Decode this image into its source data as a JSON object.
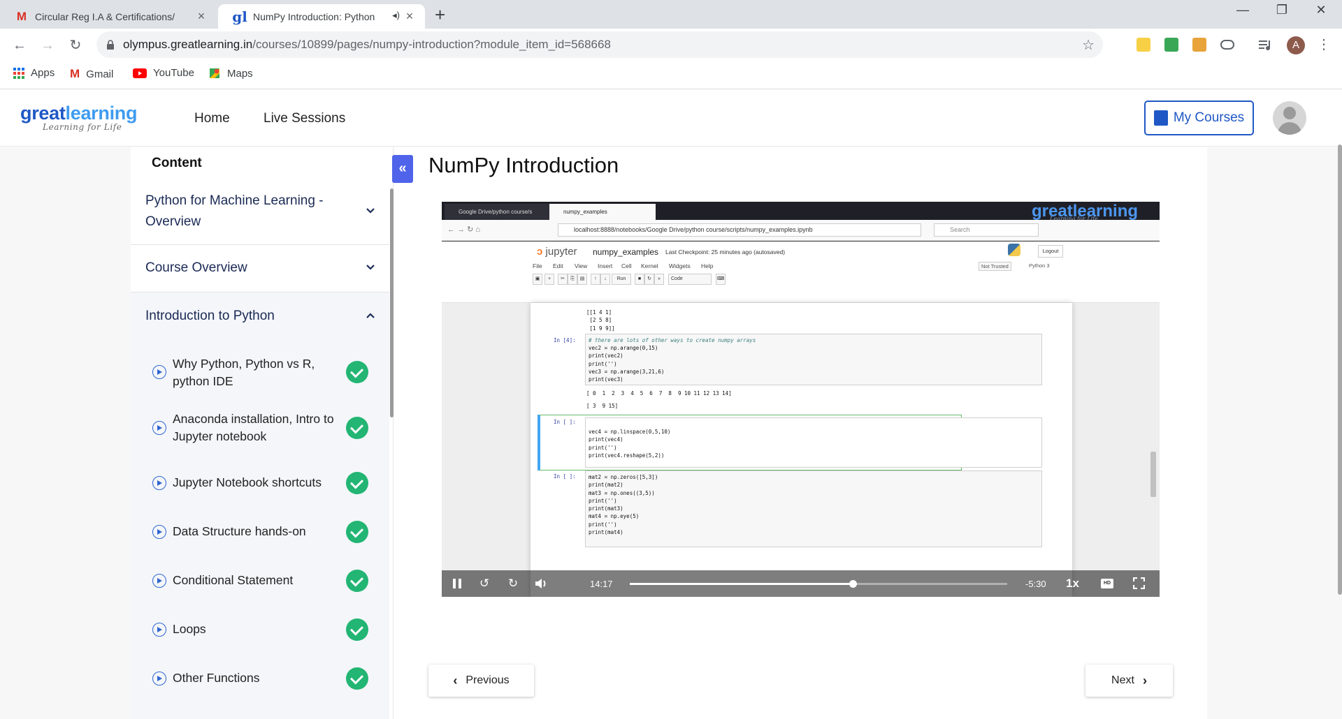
{
  "browser": {
    "tabs": [
      {
        "title": "Circular Reg I.A & Certifications/",
        "icon": "gmail-icon"
      },
      {
        "title": "NumPy Introduction: Python",
        "icon": "greatlearning-icon",
        "active": true
      }
    ],
    "new_tab": "+",
    "url_host": "olympus.greatlearning.in",
    "url_path": "/courses/10899/pages/numpy-introduction?module_item_id=568668",
    "profile_initial": "A",
    "bookmarks": [
      {
        "label": "Apps",
        "icon": "apps-grid-icon"
      },
      {
        "label": "Gmail",
        "icon": "gmail-icon"
      },
      {
        "label": "YouTube",
        "icon": "youtube-icon"
      },
      {
        "label": "Maps",
        "icon": "maps-icon"
      }
    ]
  },
  "site": {
    "logo_main_a": "great",
    "logo_main_b": "learning",
    "logo_tagline": "Learning for Life",
    "nav": [
      "Home",
      "Live Sessions"
    ],
    "my_courses": "My Courses"
  },
  "sidebar": {
    "heading": "Content",
    "modules": [
      {
        "title": "Python for Machine Learning - Overview",
        "expanded": false
      },
      {
        "title": "Course Overview",
        "expanded": false
      },
      {
        "title": "Introduction to Python",
        "expanded": true
      }
    ],
    "lessons": [
      {
        "title": "Why Python, Python vs R, python IDE",
        "completed": true
      },
      {
        "title": "Anaconda installation, Intro to Jupyter notebook",
        "completed": true
      },
      {
        "title": "Jupyter Notebook shortcuts",
        "completed": true
      },
      {
        "title": "Data Structure hands-on",
        "completed": true
      },
      {
        "title": "Conditional Statement",
        "completed": true
      },
      {
        "title": "Loops",
        "completed": true
      },
      {
        "title": "Other Functions",
        "completed": true
      }
    ]
  },
  "main": {
    "collapse_label": "«",
    "page_title": "NumPy Introduction",
    "prev_label": "Previous",
    "next_label": "Next"
  },
  "video": {
    "inner_tab1": "Google Drive/python course/s",
    "inner_tab2": "numpy_examples",
    "inner_url": "localhost:8888/notebooks/Google Drive/python course/scripts/numpy_examples.ipynb",
    "inner_search": "Search",
    "brand": "greatlearning",
    "brand_sub": "Learning for Life",
    "jupyter_logo": "jupyter",
    "notebook_name": "numpy_examples",
    "checkpoint": "Last Checkpoint: 25 minutes ago  (autosaved)",
    "logout": "Logout",
    "menus": [
      "File",
      "Edit",
      "View",
      "Insert",
      "Cell",
      "Kernel",
      "Widgets",
      "Help"
    ],
    "not_trusted": "Not Trusted",
    "kernel": "Python 3",
    "run_label": "Run",
    "cell_type": "Code",
    "output_top": "[[1 4 1]\n [2 5 8]\n [1 9 9]]",
    "cell1_prompt": "In [4]:",
    "cell1_comment": "# there are lots of other ways to create numpy arrays",
    "cell1_code": "vec2 = np.arange(0,15)\nprint(vec2)\nprint('')\nvec3 = np.arange(3,21,6)\nprint(vec3)",
    "cell1_out1": "[ 0  1  2  3  4  5  6  7  8  9 10 11 12 13 14]",
    "cell1_out2": "[ 3  9 15]",
    "cell2_prompt": "In [ ]:",
    "cell2_code": "vec4 = np.linspace(0,5,10)\nprint(vec4)\nprint('')\nprint(vec4.reshape(5,2))",
    "cell3_prompt": "In [ ]:",
    "cell3_code": "mat2 = np.zeros([5,3])\nprint(mat2)\nmat3 = np.ones((3,5))\nprint('')\nprint(mat3)\nmat4 = np.eye(5)\nprint('')\nprint(mat4)",
    "current_time": "14:17",
    "remaining_time": "-5:30",
    "progress": 0.59,
    "speed": "1x",
    "hd_label": "HD"
  }
}
